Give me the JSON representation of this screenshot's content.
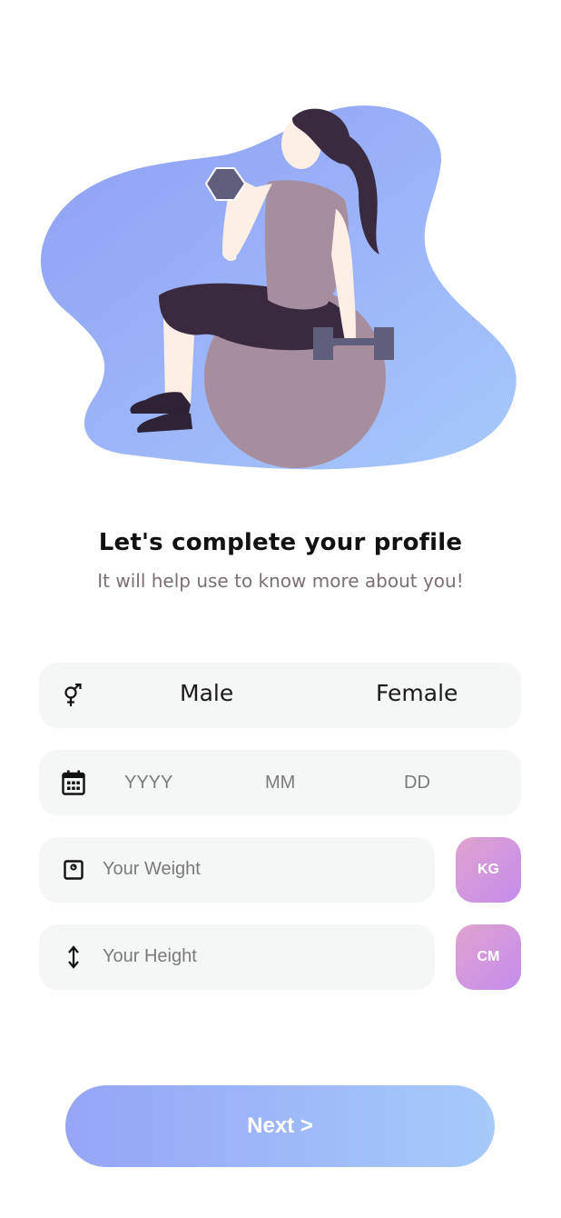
{
  "heading": {
    "title": "Let's complete your profile",
    "subtitle": "It will help use to know more about you!"
  },
  "illustration": {
    "subject": "woman lifting dumbbell on exercise ball",
    "colors": {
      "blob": "#9bb0f7",
      "ball": "#a68e9f",
      "clothes": "#3a2a40",
      "skin": "#fdeee6",
      "dumbbell": "#5f5e7c"
    }
  },
  "gender": {
    "icon": "gender-icon",
    "options": [
      "Male",
      "Female"
    ]
  },
  "dob": {
    "icon": "calendar-icon",
    "year_placeholder": "YYYY",
    "month_placeholder": "MM",
    "day_placeholder": "DD"
  },
  "weight": {
    "icon": "scale-icon",
    "placeholder": "Your Weight",
    "unit": "KG"
  },
  "height": {
    "icon": "height-arrows-icon",
    "placeholder": "Your Height",
    "unit": "CM"
  },
  "next_button": {
    "label": "Next >"
  },
  "colors": {
    "field_bg": "#f5f7f6",
    "unit_gradient": [
      "#e0a3cf",
      "#c48cec"
    ],
    "button_gradient": [
      "#95a5f5",
      "#a6cafa"
    ],
    "title": "#111111",
    "subtitle": "#7b6f72"
  }
}
